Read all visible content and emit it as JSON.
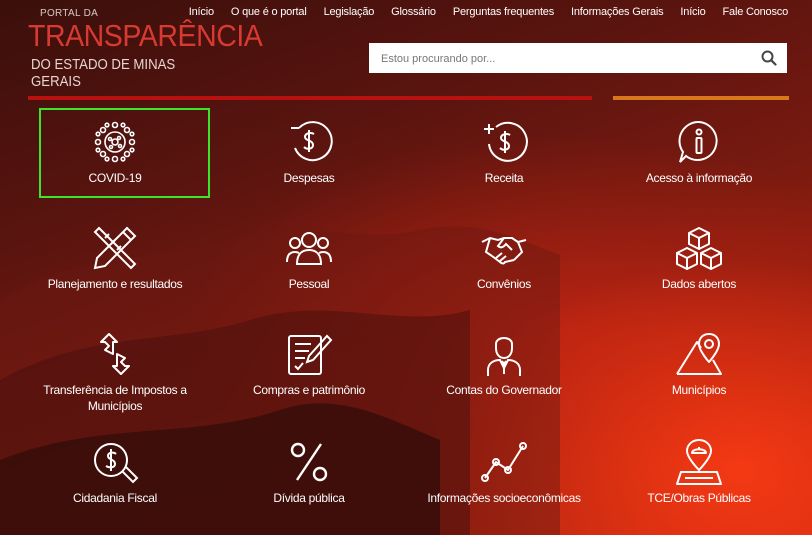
{
  "logo": {
    "line1": "PORTAL DA",
    "line2": "TRANSPARÊNCIA",
    "line3": "DO ESTADO DE MINAS GERAIS"
  },
  "nav": [
    "Início",
    "O que é o portal",
    "Legislação",
    "Glossário",
    "Perguntas frequentes",
    "Informações Gerais",
    "Início",
    "Fale Conosco"
  ],
  "search": {
    "placeholder": "Estou procurando por...",
    "icon": "search-icon"
  },
  "tiles": [
    {
      "label": "COVID-19",
      "icon": "virus-icon"
    },
    {
      "label": "Despesas",
      "icon": "money-minus-icon"
    },
    {
      "label": "Receita",
      "icon": "money-plus-icon"
    },
    {
      "label": "Acesso à informação",
      "icon": "info-icon"
    },
    {
      "label": "Planejamento e resultados",
      "icon": "pencil-ruler-icon"
    },
    {
      "label": "Pessoal",
      "icon": "people-icon"
    },
    {
      "label": "Convênios",
      "icon": "handshake-icon"
    },
    {
      "label": "Dados abertos",
      "icon": "cubes-icon"
    },
    {
      "label": "Transferência de Impostos a Municípios",
      "icon": "transfer-arrows-icon"
    },
    {
      "label": "Compras e patrimônio",
      "icon": "checklist-icon"
    },
    {
      "label": "Contas do Governador",
      "icon": "governor-icon"
    },
    {
      "label": "Municípios",
      "icon": "map-pin-icon"
    },
    {
      "label": "Cidadania Fiscal",
      "icon": "coin-magnifier-icon"
    },
    {
      "label": "Dívida pública",
      "icon": "percent-icon"
    },
    {
      "label": "Informações socioeconômicas",
      "icon": "line-graph-icon"
    },
    {
      "label": "TCE/Obras Públicas",
      "icon": "construction-icon"
    }
  ],
  "colors": {
    "accent_red": "#b7120f",
    "accent_orange": "#d9771c",
    "focus_green": "#3ce42c",
    "logo_red": "#d63a32"
  }
}
